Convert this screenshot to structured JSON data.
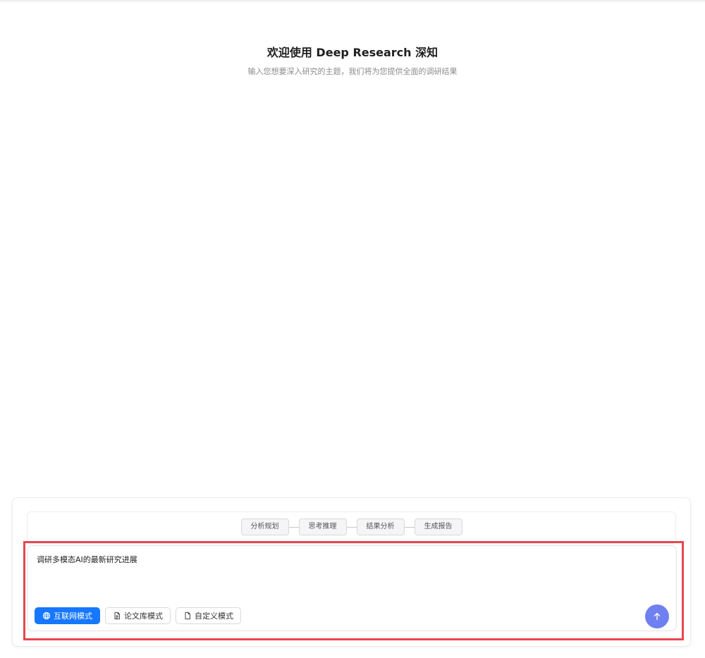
{
  "welcome": {
    "title": "欢迎使用 Deep Research 深知",
    "subtitle": "输入您想要深入研究的主题，我们将为您提供全面的调研结果"
  },
  "workflow": {
    "steps": [
      {
        "label": "分析规划"
      },
      {
        "label": "思考推理"
      },
      {
        "label": "结果分析"
      },
      {
        "label": "生成报告"
      }
    ]
  },
  "composer": {
    "query_value": "调研多模态AI的最新研究进展",
    "modes": [
      {
        "label": "互联网模式",
        "icon": "globe-icon",
        "active": true
      },
      {
        "label": "论文库模式",
        "icon": "document-text-icon",
        "active": false
      },
      {
        "label": "自定义模式",
        "icon": "file-icon",
        "active": false
      }
    ],
    "send_icon": "arrow-up-icon"
  },
  "colors": {
    "accent": "#1677ff",
    "send_button": "#6f80f0",
    "highlight": "#e8474f"
  }
}
